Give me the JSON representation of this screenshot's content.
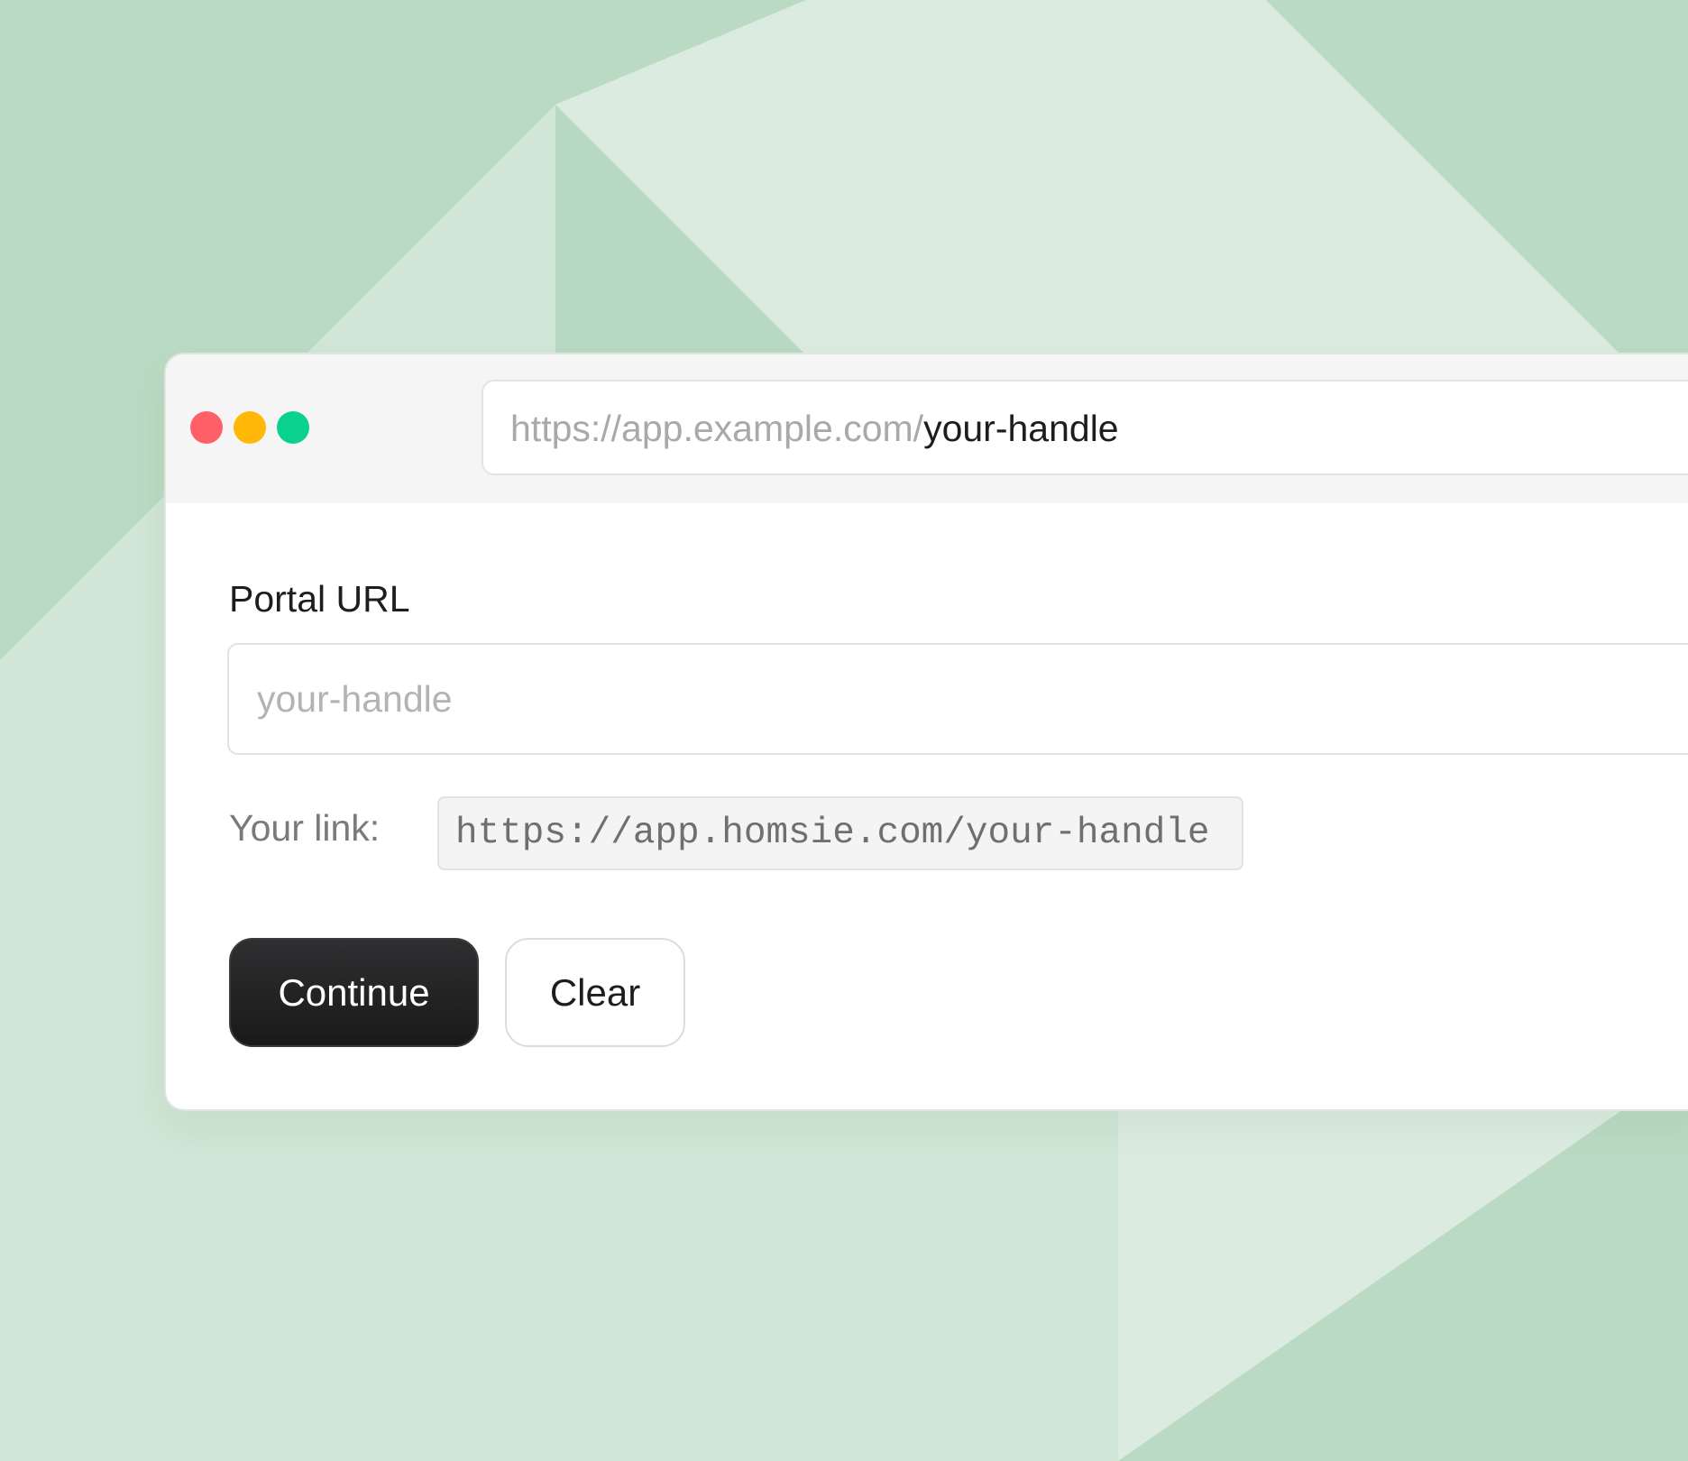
{
  "colors": {
    "background": "#bbdac3",
    "window_dot_red": "#ff5f66",
    "window_dot_yellow": "#ffb808",
    "window_dot_green": "#08d28d",
    "primary_button": "#1d1d1f"
  },
  "browser": {
    "address_base": "https://app.example.com/",
    "address_handle": "your-handle"
  },
  "form": {
    "portal_label": "Portal URL",
    "input_placeholder": "your-handle",
    "input_value": "",
    "link_label": "Your link:",
    "link_value": "https://app.homsie.com/your-handle"
  },
  "actions": {
    "continue_label": "Continue",
    "clear_label": "Clear"
  }
}
